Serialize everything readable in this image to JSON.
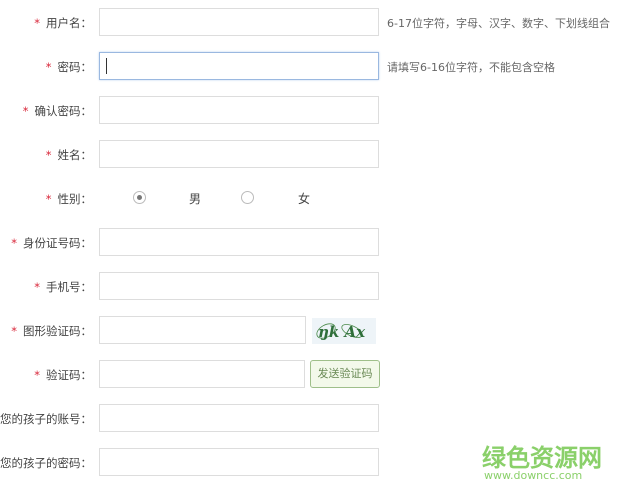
{
  "fields": [
    {
      "label": "用户名：",
      "required": true,
      "hint": "6-17位字符，字母、汉字、数字、下划线组合"
    },
    {
      "label": "密码：",
      "required": true,
      "hint": "请填写6-16位字符，不能包含空格"
    },
    {
      "label": "确认密码：",
      "required": true
    },
    {
      "label": "姓名：",
      "required": true
    },
    {
      "label": "性别：",
      "required": true
    },
    {
      "label": "身份证号码：",
      "required": true
    },
    {
      "label": "手机号：",
      "required": true
    },
    {
      "label": "图形验证码：",
      "required": true
    },
    {
      "label": "验证码：",
      "required": true
    },
    {
      "label": "您的孩子的账号：",
      "required": false
    },
    {
      "label": "您的孩子的密码：",
      "required": false
    }
  ],
  "star": "*",
  "gender": {
    "options": [
      "男",
      "女"
    ],
    "selected": "男"
  },
  "captcha_text": "ŋk Ax",
  "send_code_label": "发送验证码",
  "watermark": {
    "name": "绿色资源网",
    "url": "www.downcc.com"
  }
}
